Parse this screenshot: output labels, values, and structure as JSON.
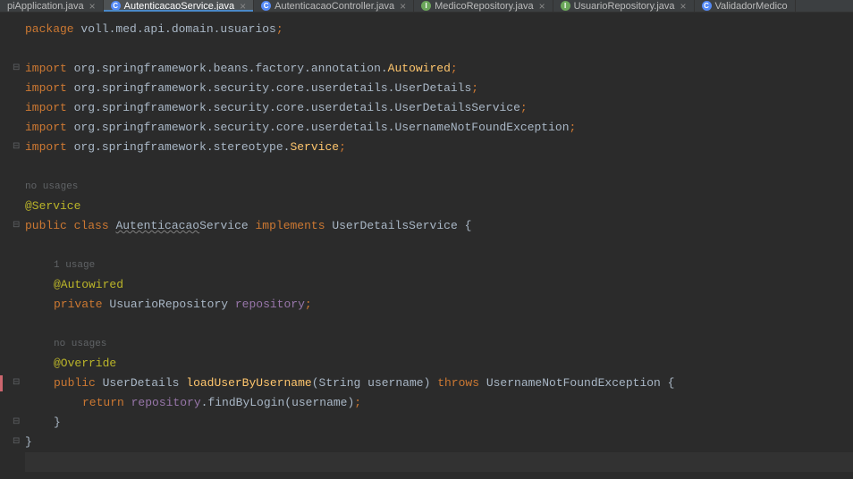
{
  "tabs": [
    {
      "label": "piApplication.java",
      "icon": "",
      "active": false
    },
    {
      "label": "AutenticacaoService.java",
      "icon": "C",
      "active": true
    },
    {
      "label": "AutenticacaoController.java",
      "icon": "C",
      "active": false
    },
    {
      "label": "MedicoRepository.java",
      "icon": "I",
      "active": false
    },
    {
      "label": "UsuarioRepository.java",
      "icon": "I",
      "active": false
    },
    {
      "label": "ValidadorMedico",
      "icon": "C",
      "active": false
    }
  ],
  "code": {
    "package_kw": "package",
    "package_val": " voll.med.api.domain.usuarios",
    "semi": ";",
    "import_kw": "import",
    "imp1a": " org.springframework.beans.factory.annotation.",
    "imp1b": "Autowired",
    "imp2": " org.springframework.security.core.userdetails.UserDetails",
    "imp3": " org.springframework.security.core.userdetails.UserDetailsService",
    "imp4": " org.springframework.security.core.userdetails.UsernameNotFoundException",
    "imp5a": " org.springframework.stereotype.",
    "imp5b": "Service",
    "hint_no_usages": "no usages",
    "hint_1_usage": "1 usage",
    "ann_service": "@Service",
    "ann_autowired": "@Autowired",
    "ann_override": "@Override",
    "public_kw": "public",
    "class_kw": "class",
    "private_kw": "private",
    "implements_kw": "implements",
    "throws_kw": "throws",
    "return_kw": "return",
    "class_name_a": "Autenticacao",
    "class_name_b": "Service",
    "user_details_service": "UserDetailsService",
    "brace_open": " {",
    "brace_close": "}",
    "usuario_repo": "UsuarioRepository",
    "repository": "repository",
    "user_details": "UserDetails",
    "load_method": "loadUserByUsername",
    "paren_open": "(",
    "paren_close": ")",
    "string_type": "String",
    "username": "username",
    "unfe": "UsernameNotFoundException",
    "find_by_login": ".findByLogin(",
    "space": " "
  }
}
